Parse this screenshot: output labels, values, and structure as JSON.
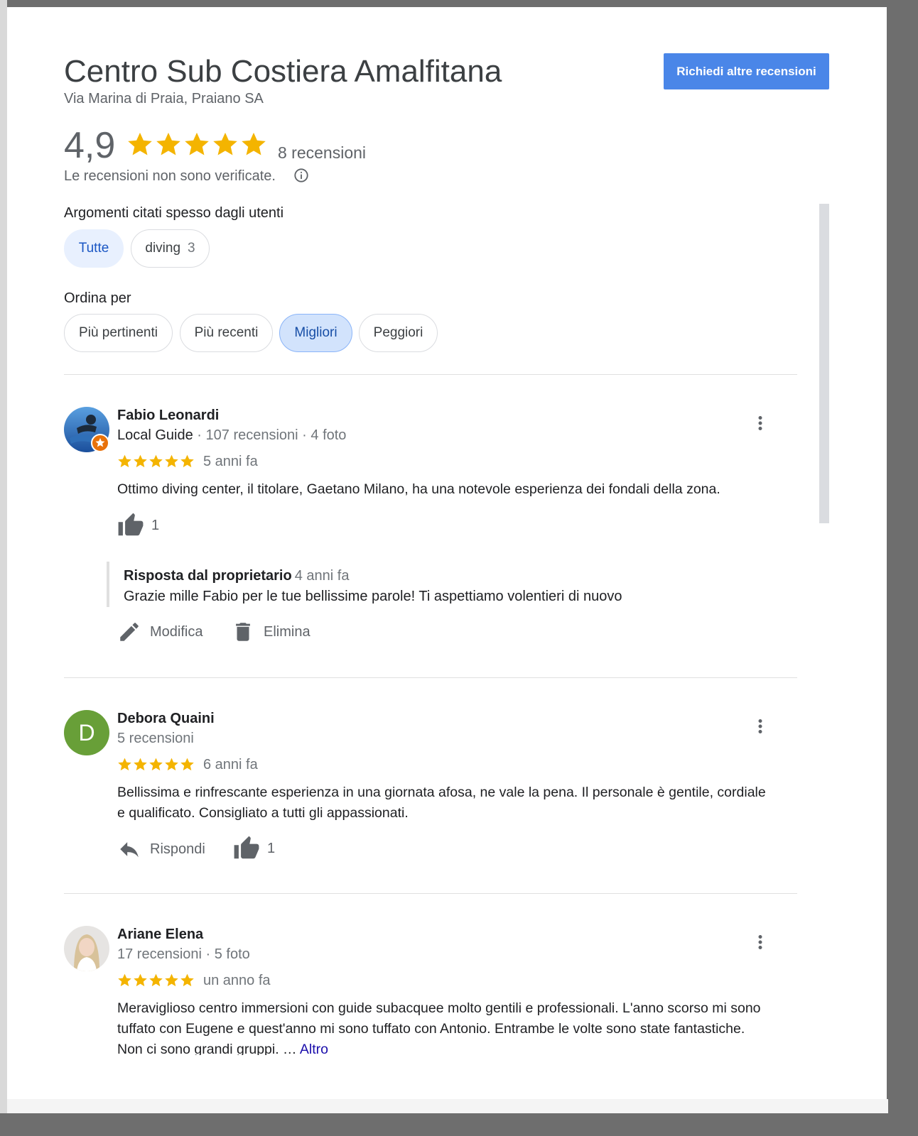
{
  "header": {
    "business_name": "Centro Sub Costiera Amalfitana",
    "address": "Via Marina di Praia, Praiano SA",
    "request_button_label": "Richiedi altre recensioni"
  },
  "summary": {
    "rating": "4,9",
    "stars": 5,
    "review_count": "8 recensioni",
    "unverified_note": "Le recensioni non sono verificate."
  },
  "topics": {
    "label": "Argomenti citati spesso dagli utenti",
    "chips": [
      {
        "label": "Tutte",
        "count": "",
        "selected": true
      },
      {
        "label": "diving",
        "count": "3",
        "selected": false
      }
    ]
  },
  "sort": {
    "label": "Ordina per",
    "options": [
      {
        "label": "Più pertinenti",
        "selected": false
      },
      {
        "label": "Più recenti",
        "selected": false
      },
      {
        "label": "Migliori",
        "selected": true
      },
      {
        "label": "Peggiori",
        "selected": false
      }
    ]
  },
  "reviews": [
    {
      "author": "Fabio Leonardi",
      "guide_label": "Local Guide",
      "meta": " · 107 recensioni · 4 foto",
      "stars": 5,
      "time": "5 anni fa",
      "text": "Ottimo diving center, il titolare, Gaetano Milano, ha una notevole esperienza dei fondali della zona.",
      "likes": "1",
      "owner_reply": {
        "title": "Risposta dal proprietario",
        "time": "4 anni fa",
        "text": "Grazie mille Fabio per le tue bellissime parole! Ti aspettiamo volentieri di nuovo"
      },
      "edit_label": "Modifica",
      "delete_label": "Elimina"
    },
    {
      "author": "Debora Quaini",
      "avatar_letter": "D",
      "avatar_color": "#689f38",
      "meta": "5 recensioni",
      "stars": 5,
      "time": "6 anni fa",
      "text": "Bellissima e rinfrescante esperienza in una giornata afosa, ne vale la pena. Il personale è gentile, cordiale e qualificato. Consigliato a tutti gli appassionati.",
      "reply_label": "Rispondi",
      "likes": "1"
    },
    {
      "author": "Ariane Elena",
      "meta": "17 recensioni · 5 foto",
      "stars": 5,
      "time": "un anno fa",
      "text": "Meraviglioso centro immersioni con guide subacquee molto gentili e professionali. L'anno scorso mi sono tuffato con Eugene e quest'anno mi sono tuffato con Antonio. Entrambe le volte sono state fantastiche. Non ci sono grandi gruppi. …",
      "more_label": "Altro"
    }
  ],
  "colors": {
    "star": "#f4b400",
    "accent_button": "#4a86e8",
    "link": "#1a0dab"
  },
  "icons": [
    "star-icon",
    "info-icon",
    "more-vert-icon",
    "thumb-up-icon",
    "edit-icon",
    "delete-icon",
    "reply-icon",
    "local-guide-badge-icon"
  ]
}
